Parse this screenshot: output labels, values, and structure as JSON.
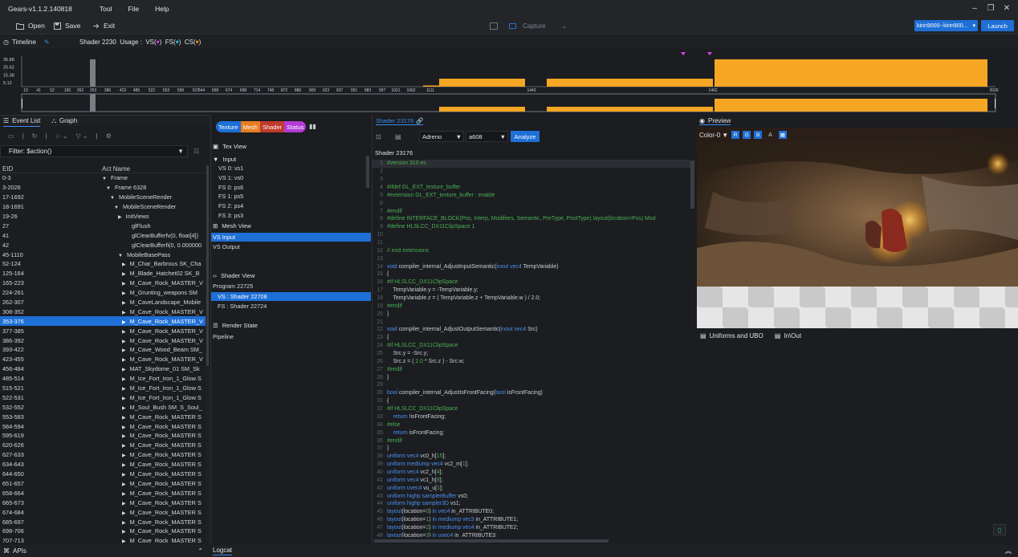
{
  "app": {
    "title": "Gears-v1.1.2.140818",
    "menu": [
      "Tool",
      "File",
      "Help"
    ],
    "window_buttons": [
      "–",
      "❐",
      "✕"
    ]
  },
  "toolbar": {
    "open": "Open",
    "save": "Save",
    "exit": "Exit",
    "capture": "Capture",
    "device": "kirin9000--kirin900...",
    "launch": "Launch"
  },
  "timeline": {
    "label": "Timeline",
    "shader": "Shader 2230",
    "usage": "Usage :",
    "vs": "VS(",
    "fs": "FS(",
    "cs": "CS(",
    "close": ")",
    "y_ticks": [
      "35.88",
      "25.62",
      "15.38",
      "5.12"
    ],
    "x_ticks": [
      "19",
      "41",
      "52",
      "165",
      "262",
      "353",
      "386",
      "423",
      "485",
      "522",
      "553",
      "596",
      "627",
      "644",
      "658",
      "674",
      "698",
      "714",
      "748",
      "872",
      "886",
      "909",
      "923",
      "937",
      "951",
      "983",
      "997",
      "1021",
      "1062",
      "1111",
      "1443",
      "1462",
      "2026"
    ]
  },
  "chart_data": {
    "type": "bar",
    "title": "",
    "xlabel": "",
    "ylabel": "",
    "ylim": [
      0,
      40
    ],
    "categories": [
      "353",
      "1111-1443",
      "1443-1462",
      "1462-2026"
    ],
    "series": [
      {
        "values": [
          35.88,
          10.5,
          10.5,
          35.88
        ]
      }
    ]
  },
  "left": {
    "tabs": [
      "Event List",
      "Graph"
    ],
    "filter": "Filter: $action()",
    "col_eid": "EID",
    "col_act": "Act Name",
    "rows": [
      {
        "eid": "0-3",
        "act": "Frame",
        "indent": 0,
        "arrow": "▼"
      },
      {
        "eid": "3-2026",
        "act": "Frame 6328",
        "indent": 1,
        "arrow": "▼"
      },
      {
        "eid": "17-1692",
        "act": "MobileSceneRender",
        "indent": 2,
        "arrow": "▼"
      },
      {
        "eid": "18-1691",
        "act": "MobileSceneRender",
        "indent": 3,
        "arrow": "▼"
      },
      {
        "eid": "19-26",
        "act": "InitViews",
        "indent": 4,
        "arrow": "▶"
      },
      {
        "eid": "27",
        "act": "glFlush",
        "indent": 5,
        "arrow": ""
      },
      {
        "eid": "41",
        "act": "glClearBufferfv(0, float[4])",
        "indent": 5,
        "arrow": ""
      },
      {
        "eid": "42",
        "act": "glClearBufferfi(0, 0.000000",
        "indent": 5,
        "arrow": ""
      },
      {
        "eid": "45-1110",
        "act": "MobileBasePass",
        "indent": 4,
        "arrow": "▼"
      },
      {
        "eid": "52-124",
        "act": "M_Char_Barbrous SK_Cha",
        "indent": 5,
        "arrow": "▶"
      },
      {
        "eid": "125-164",
        "act": "M_Blade_Hatchet02 SK_B",
        "indent": 5,
        "arrow": "▶"
      },
      {
        "eid": "165-223",
        "act": "M_Cave_Rock_MASTER_V",
        "indent": 5,
        "arrow": "▶"
      },
      {
        "eid": "224-261",
        "act": "M_Grunting_weapons SM",
        "indent": 5,
        "arrow": "▶"
      },
      {
        "eid": "262-307",
        "act": "M_CaveLandscape_Mobile",
        "indent": 5,
        "arrow": "▶"
      },
      {
        "eid": "308-352",
        "act": "M_Cave_Rock_MASTER_V",
        "indent": 5,
        "arrow": "▶"
      },
      {
        "eid": "353-376",
        "act": "M_Cave_Rock_MASTER_V",
        "indent": 5,
        "arrow": "▶",
        "sel": true
      },
      {
        "eid": "377-385",
        "act": "M_Cave_Rock_MASTER_V",
        "indent": 5,
        "arrow": "▶"
      },
      {
        "eid": "386-392",
        "act": "M_Cave_Rock_MASTER_V",
        "indent": 5,
        "arrow": "▶"
      },
      {
        "eid": "393-422",
        "act": "M_Cave_Wood_Beam SM_",
        "indent": 5,
        "arrow": "▶"
      },
      {
        "eid": "423-455",
        "act": "M_Cave_Rock_MASTER_V",
        "indent": 5,
        "arrow": "▶"
      },
      {
        "eid": "456-484",
        "act": "MAT_Skydome_01 SM_Sk",
        "indent": 5,
        "arrow": "▶"
      },
      {
        "eid": "485-514",
        "act": "M_Ice_Fort_Iron_1_Glow S",
        "indent": 5,
        "arrow": "▶"
      },
      {
        "eid": "515-521",
        "act": "M_Ice_Fort_Iron_1_Glow S",
        "indent": 5,
        "arrow": "▶"
      },
      {
        "eid": "522-531",
        "act": "M_Ice_Fort_Iron_1_Glow S",
        "indent": 5,
        "arrow": "▶"
      },
      {
        "eid": "532-552",
        "act": "M_Soul_Bush SM_S_Soul_",
        "indent": 5,
        "arrow": "▶"
      },
      {
        "eid": "553-583",
        "act": "M_Cave_Rock_MASTER S",
        "indent": 5,
        "arrow": "▶"
      },
      {
        "eid": "584-594",
        "act": "M_Cave_Rock_MASTER S",
        "indent": 5,
        "arrow": "▶"
      },
      {
        "eid": "595-619",
        "act": "M_Cave_Rock_MASTER S",
        "indent": 5,
        "arrow": "▶"
      },
      {
        "eid": "620-626",
        "act": "M_Cave_Rock_MASTER S",
        "indent": 5,
        "arrow": "▶"
      },
      {
        "eid": "627-633",
        "act": "M_Cave_Rock_MASTER S",
        "indent": 5,
        "arrow": "▶"
      },
      {
        "eid": "634-643",
        "act": "M_Cave_Rock_MASTER S",
        "indent": 5,
        "arrow": "▶"
      },
      {
        "eid": "644-650",
        "act": "M_Cave_Rock_MASTER S",
        "indent": 5,
        "arrow": "▶"
      },
      {
        "eid": "651-657",
        "act": "M_Cave_Rock_MASTER S",
        "indent": 5,
        "arrow": "▶"
      },
      {
        "eid": "658-664",
        "act": "M_Cave_Rock_MASTER S",
        "indent": 5,
        "arrow": "▶"
      },
      {
        "eid": "665-673",
        "act": "M_Cave_Rock_MASTER S",
        "indent": 5,
        "arrow": "▶"
      },
      {
        "eid": "674-684",
        "act": "M_Cave_Rock_MASTER S",
        "indent": 5,
        "arrow": "▶"
      },
      {
        "eid": "685-697",
        "act": "M_Cave_Rock_MASTER S",
        "indent": 5,
        "arrow": "▶"
      },
      {
        "eid": "698-706",
        "act": "M_Cave_Rock_MASTER S",
        "indent": 5,
        "arrow": "▶"
      },
      {
        "eid": "707-713",
        "act": "M_Cave_Rock_MASTER S",
        "indent": 5,
        "arrow": "▶"
      }
    ],
    "apis": "APIs"
  },
  "middle": {
    "pills": [
      "Texture",
      "Mesh",
      "Shader",
      "Status"
    ],
    "tex_view": "Tex View",
    "input": "Input",
    "inputs": [
      "VS 0: vs1",
      "VS 1: vs0",
      "FS 0: ps6",
      "FS 1: ps5",
      "FS 2: ps4",
      "FS 3: ps3"
    ],
    "mesh_view": "Mesh View",
    "vs_input": "VS Input",
    "vs_output": "VS Output",
    "shader_view": "Shader View",
    "program": "Program 22725",
    "vs_shader": "VS : Shader 22708",
    "fs_shader": "FS : Shader 22724",
    "render_state": "Render State",
    "pipeline": "Pipeline"
  },
  "code": {
    "tab": "Shader 23176",
    "gpu": "Adreno",
    "model": "a608",
    "analyze": "Analyze",
    "name": "Shader 23176",
    "lines": [
      [
        [
          "#version 310 es",
          "#4caf50"
        ]
      ],
      [],
      [],
      [
        [
          "#ifdef GL_EXT_texture_buffer",
          "#4caf50"
        ]
      ],
      [
        [
          "#extension GL_EXT_texture_buffer : enable",
          "#4caf50"
        ]
      ],
      [],
      [
        [
          "#endif",
          "#4caf50"
        ]
      ],
      [
        [
          "#define INTERFACE_BLOCK(Pos, Interp, Modifiers, Semantic, PreType, PostType) layout(location=Pos) Mod",
          "#4caf50"
        ]
      ],
      [
        [
          "#define HLSLCC_DX11ClipSpace ",
          "#4caf50"
        ],
        [
          "1",
          "#4caf50"
        ]
      ],
      [],
      [],
      [
        [
          "// end extensions",
          "#4caf50"
        ]
      ],
      [],
      [
        [
          "void ",
          "#4f8ff0"
        ],
        [
          "compiler_internal_AdjustInputSemantic(",
          ""
        ],
        [
          "inout vec4 ",
          "#4f8ff0"
        ],
        [
          "TempVariable)",
          ""
        ]
      ],
      [
        [
          "{",
          ""
        ]
      ],
      [
        [
          "#if HLSLCC_DX11ClipSpace",
          "#4caf50"
        ]
      ],
      [
        [
          "    TempVariable.y = -TempVariable.y;",
          ""
        ]
      ],
      [
        [
          "    TempVariable.z = ( TempVariable.z + TempVariable.w ) / ",
          ""
        ],
        [
          "2.0",
          ""
        ],
        [
          ";",
          ""
        ]
      ],
      [
        [
          "#endif",
          "#4caf50"
        ]
      ],
      [
        [
          "}",
          ""
        ]
      ],
      [],
      [
        [
          "void ",
          "#4f8ff0"
        ],
        [
          "compiler_internal_AdjustOutputSemantic(",
          ""
        ],
        [
          "inout vec4 ",
          "#4f8ff0"
        ],
        [
          "Src)",
          ""
        ]
      ],
      [
        [
          "{",
          ""
        ]
      ],
      [
        [
          "#if HLSLCC_DX11ClipSpace",
          "#4caf50"
        ]
      ],
      [
        [
          "    Src.y = -Src.y;",
          ""
        ]
      ],
      [
        [
          "    Src.z = ( ",
          ""
        ],
        [
          "2.0",
          "#4caf50"
        ],
        [
          " * Src.z ) - Src.w;",
          ""
        ]
      ],
      [
        [
          "#endif",
          "#4caf50"
        ]
      ],
      [
        [
          "}",
          ""
        ]
      ],
      [],
      [
        [
          "bool ",
          "#4f8ff0"
        ],
        [
          "compiler_internal_AdjustIsFrontFacing(",
          ""
        ],
        [
          "bool ",
          "#4f8ff0"
        ],
        [
          "isFrontFacing)",
          ""
        ]
      ],
      [
        [
          "{",
          ""
        ]
      ],
      [
        [
          "#if HLSLCC_DX11ClipSpace",
          "#4caf50"
        ]
      ],
      [
        [
          "    return ",
          "#4f8ff0"
        ],
        [
          "!isFrontFacing;",
          ""
        ]
      ],
      [
        [
          "#else",
          "#4caf50"
        ]
      ],
      [
        [
          "    return ",
          "#4f8ff0"
        ],
        [
          "isFrontFacing;",
          ""
        ]
      ],
      [
        [
          "#endif",
          "#4caf50"
        ]
      ],
      [
        [
          "}",
          ""
        ]
      ],
      [
        [
          "uniform vec4 ",
          "#4f8ff0"
        ],
        [
          "vc0_h[",
          ""
        ],
        [
          "15",
          "#4caf50"
        ],
        [
          "];",
          ""
        ]
      ],
      [
        [
          "uniform mediump vec4 ",
          "#4f8ff0"
        ],
        [
          "vc2_m[",
          ""
        ],
        [
          "1",
          "#4caf50"
        ],
        [
          "];",
          ""
        ]
      ],
      [
        [
          "uniform vec4 ",
          "#4f8ff0"
        ],
        [
          "vc2_h[",
          ""
        ],
        [
          "4",
          "#4caf50"
        ],
        [
          "];",
          ""
        ]
      ],
      [
        [
          "uniform vec4 ",
          "#4f8ff0"
        ],
        [
          "vc1_h[",
          ""
        ],
        [
          "8",
          "#4caf50"
        ],
        [
          "];",
          ""
        ]
      ],
      [
        [
          "uniform uvec4 ",
          "#4f8ff0"
        ],
        [
          "vu_u[",
          ""
        ],
        [
          "1",
          "#4caf50"
        ],
        [
          "];",
          ""
        ]
      ],
      [
        [
          "uniform highp samplerBuffer ",
          "#4f8ff0"
        ],
        [
          "vs0;",
          ""
        ]
      ],
      [
        [
          "uniform highp sampler3D ",
          "#4f8ff0"
        ],
        [
          "vs1;",
          ""
        ]
      ],
      [
        [
          "layout",
          "#4f8ff0"
        ],
        [
          "(location=",
          ""
        ],
        [
          "0",
          "#4caf50"
        ],
        [
          ") ",
          ""
        ],
        [
          "in vec4 ",
          "#4f8ff0"
        ],
        [
          "in_ATTRIBUTE0;",
          ""
        ]
      ],
      [
        [
          "layout",
          "#4f8ff0"
        ],
        [
          "(location=",
          ""
        ],
        [
          "1",
          "#4caf50"
        ],
        [
          ") ",
          ""
        ],
        [
          "in mediump vec3 ",
          "#4f8ff0"
        ],
        [
          "in_ATTRIBUTE1;",
          ""
        ]
      ],
      [
        [
          "layout",
          "#4f8ff0"
        ],
        [
          "(location=",
          ""
        ],
        [
          "2",
          "#4caf50"
        ],
        [
          ") ",
          ""
        ],
        [
          "in mediump vec4 ",
          "#4f8ff0"
        ],
        [
          "in_ATTRIBUTE2;",
          ""
        ]
      ],
      [
        [
          "layout",
          "#4f8ff0"
        ],
        [
          "(location=",
          ""
        ],
        [
          "3",
          "#4caf50"
        ],
        [
          ") ",
          ""
        ],
        [
          "in uvec4 ",
          "#4f8ff0"
        ],
        [
          "in_ATTRIBUTE3;",
          ""
        ]
      ]
    ]
  },
  "preview": {
    "title": "Preview",
    "channel": "Color-0",
    "ch_r": "R",
    "ch_g": "G",
    "ch_b": "B",
    "ch_a": "A",
    "uniforms": "Uniforms and UBO",
    "inout": "In\\Out"
  },
  "bottom": {
    "logcat": "Logcat"
  }
}
